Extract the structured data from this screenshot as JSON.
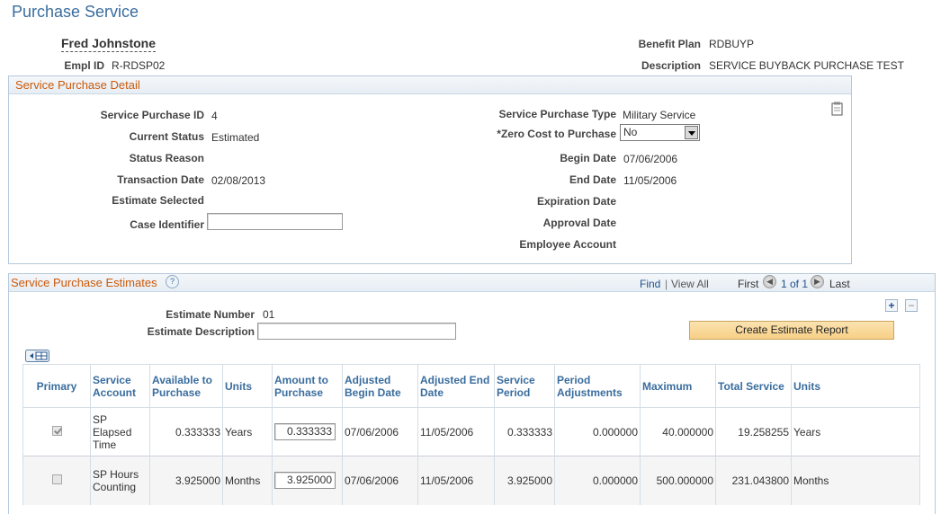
{
  "page": {
    "title": "Purchase Service"
  },
  "employee": {
    "name": "Fred Johnstone",
    "empl_id_label": "Empl ID",
    "empl_id": "R-RDSP02",
    "benefit_plan_label": "Benefit Plan",
    "benefit_plan": "RDBUYP",
    "description_label": "Description",
    "description": "SERVICE BUYBACK PURCHASE TEST"
  },
  "detail": {
    "title": "Service Purchase Detail",
    "service_purchase_id_label": "Service Purchase ID",
    "service_purchase_id": "4",
    "current_status_label": "Current Status",
    "current_status": "Estimated",
    "status_reason_label": "Status Reason",
    "transaction_date_label": "Transaction Date",
    "transaction_date": "02/08/2013",
    "estimate_selected_label": "Estimate Selected",
    "case_identifier_label": "Case Identifier",
    "case_identifier": "",
    "purchase_type_label": "Service Purchase Type",
    "purchase_type": "Military Service",
    "zero_cost_label": "*Zero Cost to Purchase",
    "zero_cost_value": "No",
    "begin_date_label": "Begin Date",
    "begin_date": "07/06/2006",
    "end_date_label": "End Date",
    "end_date": "11/05/2006",
    "expiration_date_label": "Expiration Date",
    "approval_date_label": "Approval Date",
    "employee_account_label": "Employee Account",
    "notepad_icon": "notepad-icon"
  },
  "estimates": {
    "title": "Service Purchase Estimates",
    "help_icon": "?",
    "find_label": "Find",
    "separator": "|",
    "view_all_label": "View All",
    "first_label": "First",
    "page_count": "1 of 1",
    "last_label": "Last",
    "add_icon": "+",
    "remove_icon": "−",
    "estimate_number_label": "Estimate Number",
    "estimate_number": "01",
    "estimate_description_label": "Estimate Description",
    "estimate_description": "",
    "create_report_label": "Create Estimate Report",
    "grid_icon_label": "⊞",
    "columns": [
      "Primary",
      "Service Account",
      "Available to Purchase",
      "Units",
      "Amount to Purchase",
      "Adjusted Begin Date",
      "Adjusted End Date",
      "Service Period",
      "Period Adjustments",
      "Maximum",
      "Total Service",
      "Units"
    ],
    "rows": [
      {
        "primary": true,
        "service_account": "SP Elapsed Time",
        "available": "0.333333",
        "units": "Years",
        "amount": "0.333333",
        "adj_begin": "07/06/2006",
        "adj_end": "11/05/2006",
        "service_period": "0.333333",
        "period_adjustments": "0.000000",
        "maximum": "40.000000",
        "total_service": "19.258255",
        "total_units": "Years"
      },
      {
        "primary": false,
        "service_account": "SP Hours Counting",
        "available": "3.925000",
        "units": "Months",
        "amount": "3.925000",
        "adj_begin": "07/06/2006",
        "adj_end": "11/05/2006",
        "service_period": "3.925000",
        "period_adjustments": "0.000000",
        "maximum": "500.000000",
        "total_service": "231.043800",
        "total_units": "Months"
      }
    ]
  }
}
